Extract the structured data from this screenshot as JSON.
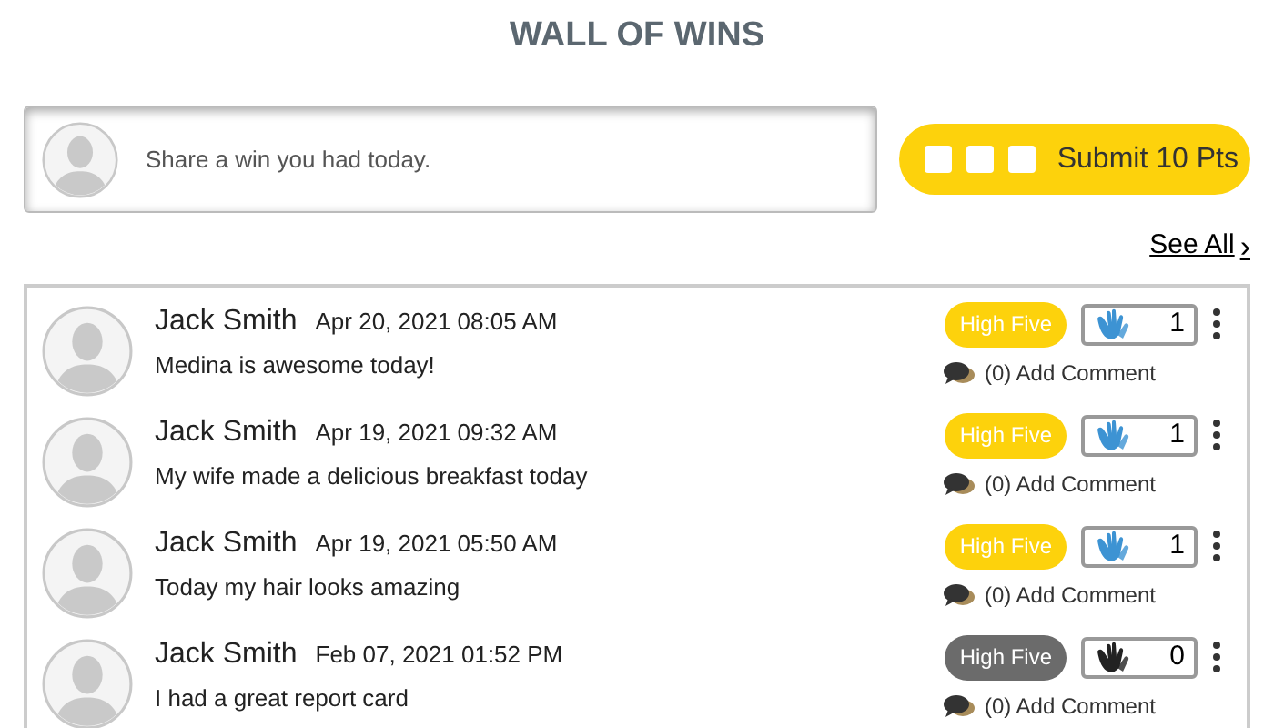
{
  "title": "WALL OF WINS",
  "composer": {
    "placeholder": "Share a win you had today."
  },
  "submit": {
    "label": "Submit 10 Pts",
    "boxes": [
      {
        "checked": false
      },
      {
        "checked": false
      },
      {
        "checked": false
      }
    ]
  },
  "see_all": "See All",
  "see_all_icon": "›",
  "posts": [
    {
      "name": "Jack Smith",
      "date": "Apr 20, 2021 08:05 AM",
      "text": "Medina is awesome today!",
      "high_five_label": "High Five",
      "high_fived": true,
      "count": "1",
      "comments": "(0) Add Comment"
    },
    {
      "name": "Jack Smith",
      "date": "Apr 19, 2021 09:32 AM",
      "text": "My wife made a delicious breakfast today",
      "high_five_label": "High Five",
      "high_fived": true,
      "count": "1",
      "comments": "(0) Add Comment"
    },
    {
      "name": "Jack Smith",
      "date": "Apr 19, 2021 05:50 AM",
      "text": "Today my hair looks amazing",
      "high_five_label": "High Five",
      "high_fived": true,
      "count": "1",
      "comments": "(0) Add Comment"
    },
    {
      "name": "Jack Smith",
      "date": "Feb 07, 2021 01:52 PM",
      "text": "I had a great report card",
      "high_five_label": "High Five",
      "high_fived": false,
      "count": "0",
      "comments": "(0) Add Comment"
    }
  ]
}
